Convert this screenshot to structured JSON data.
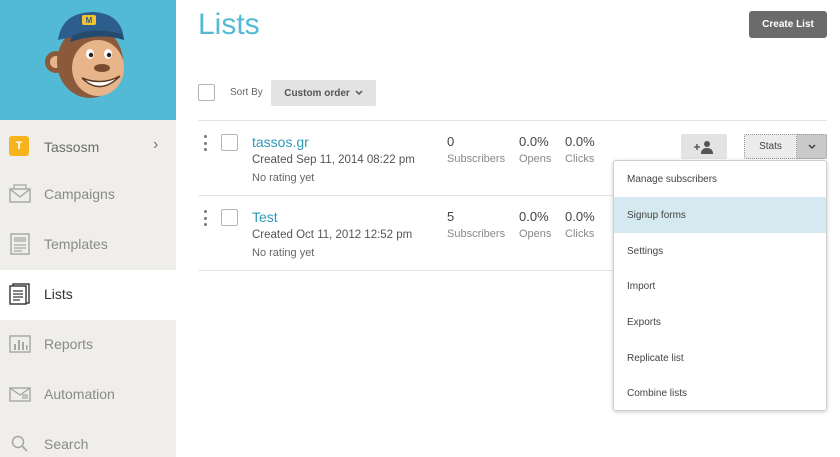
{
  "sidebar": {
    "account": {
      "badge": "T",
      "name": "Tassosm",
      "chevron": "›"
    },
    "items": [
      {
        "label": "Campaigns",
        "icon": "envelope-icon"
      },
      {
        "label": "Templates",
        "icon": "template-icon"
      },
      {
        "label": "Lists",
        "icon": "list-icon",
        "active": true
      },
      {
        "label": "Reports",
        "icon": "bar-chart-icon"
      },
      {
        "label": "Automation",
        "icon": "automation-icon"
      },
      {
        "label": "Search",
        "icon": "search-icon"
      }
    ]
  },
  "header": {
    "title": "Lists",
    "create_label": "Create List"
  },
  "toolbar": {
    "sort_label": "Sort By",
    "sort_value": "Custom order"
  },
  "lists": [
    {
      "name": "tassos.gr",
      "created": "Created Sep 11, 2014 08:22 pm",
      "rating": "No rating yet",
      "subscribers": "0",
      "subscribers_label": "Subscribers",
      "opens": "0.0%",
      "opens_label": "Opens",
      "clicks": "0.0%",
      "clicks_label": "Clicks",
      "stats_label": "Stats"
    },
    {
      "name": "Test",
      "created": "Created Oct 11, 2012 12:52 pm",
      "rating": "No rating yet",
      "subscribers": "5",
      "subscribers_label": "Subscribers",
      "opens": "0.0%",
      "opens_label": "Opens",
      "clicks": "0.0%",
      "clicks_label": "Clicks"
    }
  ],
  "dropdown": {
    "items": [
      "Manage subscribers",
      "Signup forms",
      "Settings",
      "Import",
      "Exports",
      "Replicate list",
      "Combine lists"
    ],
    "highlighted_index": 1
  },
  "colors": {
    "brand": "#52bad5",
    "link": "#2c9ab7",
    "sidebar_bg": "#efeeea",
    "highlight": "#d4eaf0"
  }
}
